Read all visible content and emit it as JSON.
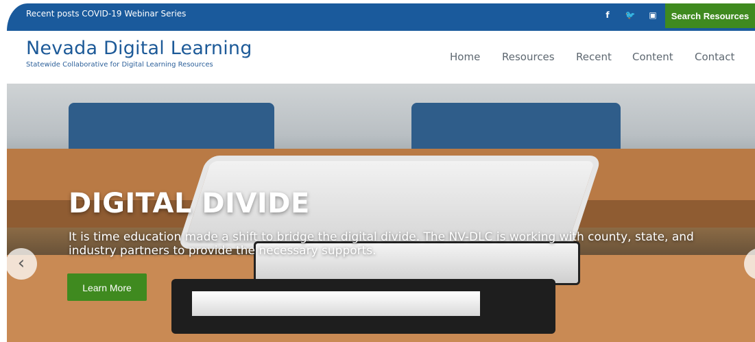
{
  "topbar": {
    "recent_label": "Recent posts",
    "recent_item": "COVID-19 Webinar Series",
    "social": {
      "facebook": "f",
      "twitter": "🐦",
      "youtube": "▣"
    },
    "search_button": "Search Resources"
  },
  "header": {
    "logo_title": "Nevada Digital Learning",
    "logo_subtitle": "Statewide Collaborative for Digital Learning Resources",
    "nav": [
      "Home",
      "Resources",
      "Recent",
      "Content",
      "Contact"
    ]
  },
  "hero": {
    "title": "DIGITAL DIVIDE",
    "text": "It is time education made a shift to bridge the digital divide. The NV-DLC is working with county, state, and industry partners to provide the necessary supports.",
    "button": "Learn More",
    "prev_icon": "‹"
  },
  "colors": {
    "topbar": "#1a5a9c",
    "accent_green": "#3f8a1f",
    "logo_blue": "#1d5a98"
  }
}
